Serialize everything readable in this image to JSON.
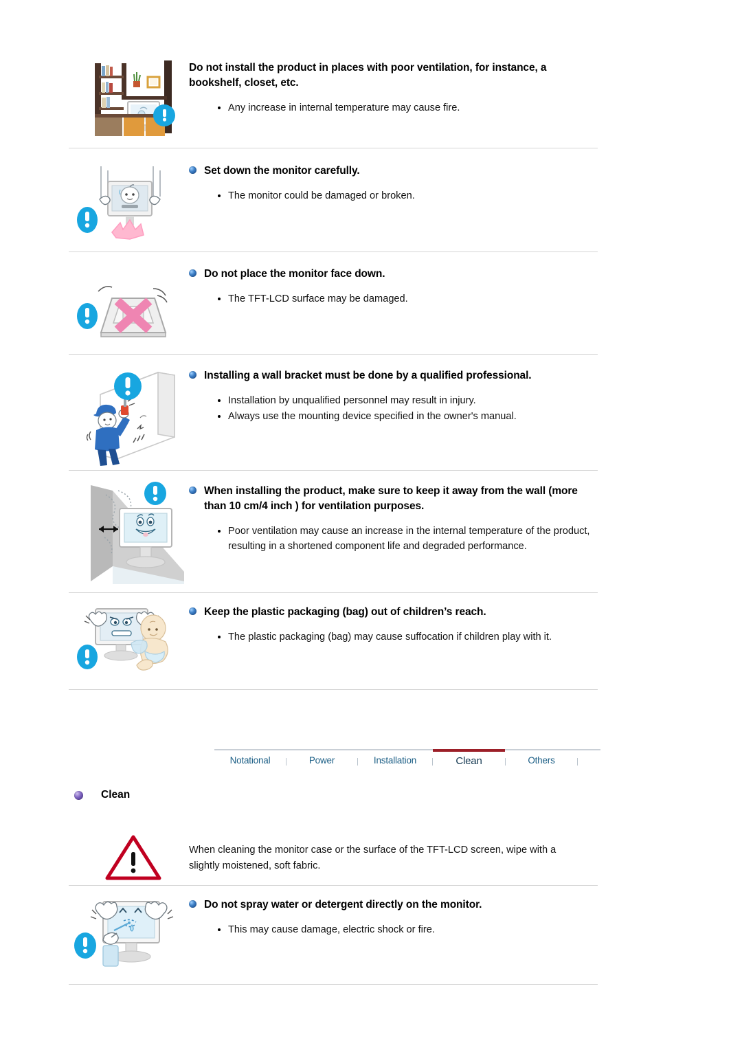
{
  "document": {
    "title": "Safety Instructions — Installation / Clean",
    "background": "#ffffff"
  },
  "colors": {
    "heading_bullet_blue": "#2f6fb5",
    "heading_bullet_purple": "#6f58ae",
    "tab_link": "#1c5f86",
    "tab_active_text": "#11364f",
    "tab_active_underline": "#9c1f28",
    "divider": "#d4d4d4",
    "warning_red": "#c00020",
    "badge_blue": "#18a6e0"
  },
  "sections": {
    "installation": {
      "items": [
        {
          "id": "ventilation-bookshelf",
          "heading": "Do not install the product in places with poor ventilation, for instance, a bookshelf, closet, etc.",
          "heading_has_bullet": false,
          "points": [
            "Any increase in internal temperature may cause fire."
          ],
          "figure_name": "bookshelf-monitor-illustration",
          "badge_glyph": "!"
        },
        {
          "id": "set-down-carefully",
          "heading": "Set down the monitor carefully.",
          "heading_has_bullet": true,
          "points": [
            "The monitor could be damaged or broken."
          ],
          "figure_name": "dropping-monitor-illustration",
          "badge_glyph": "!"
        },
        {
          "id": "face-down",
          "heading": "Do not place the monitor face down.",
          "heading_has_bullet": true,
          "points": [
            "The TFT-LCD surface may be damaged."
          ],
          "figure_name": "monitor-face-down-illustration",
          "badge_glyph": "!"
        },
        {
          "id": "wall-bracket",
          "heading": "Installing a wall bracket must be done by a qualified professional.",
          "heading_has_bullet": true,
          "points": [
            "Installation by unqualified personnel may result in injury.",
            "Always use the mounting device specified in the owner's manual."
          ],
          "figure_name": "wall-bracket-installer-illustration",
          "badge_glyph": "!"
        },
        {
          "id": "keep-away-from-wall",
          "heading": "When installing the product, make sure to keep it away from the wall (more than 10 cm/4 inch ) for ventilation purposes.",
          "heading_has_bullet": true,
          "points": [
            "Poor ventilation may cause an increase in the internal temperature of the product, resulting in a shortened component life and degraded performance."
          ],
          "figure_name": "monitor-wall-clearance-illustration",
          "badge_glyph": "!"
        },
        {
          "id": "plastic-packaging",
          "heading": "Keep the plastic packaging (bag) out of children’s reach.",
          "heading_has_bullet": true,
          "points": [
            "The plastic packaging (bag) may cause suffocation if children play with it."
          ],
          "figure_name": "baby-plastic-bag-illustration",
          "badge_glyph": "!"
        }
      ]
    },
    "clean": {
      "section_title": "Clean",
      "section_bullet_color": "purple",
      "intro": {
        "id": "clean-intro",
        "figure_name": "warning-triangle-icon",
        "text": "When cleaning the monitor case or the surface of the TFT-LCD screen, wipe with a slightly moistened, soft fabric."
      },
      "items": [
        {
          "id": "no-spray",
          "heading": "Do not spray water or detergent directly on the monitor.",
          "heading_has_bullet": true,
          "points": [
            "This may cause damage, electric shock or fire."
          ],
          "figure_name": "spray-monitor-illustration",
          "badge_glyph": "!"
        }
      ]
    }
  },
  "tabs": {
    "items": [
      {
        "label": "Notational",
        "active": false
      },
      {
        "label": "Power",
        "active": false
      },
      {
        "label": "Installation",
        "active": false
      },
      {
        "label": "Clean",
        "active": true
      },
      {
        "label": "Others",
        "active": false
      }
    ]
  }
}
